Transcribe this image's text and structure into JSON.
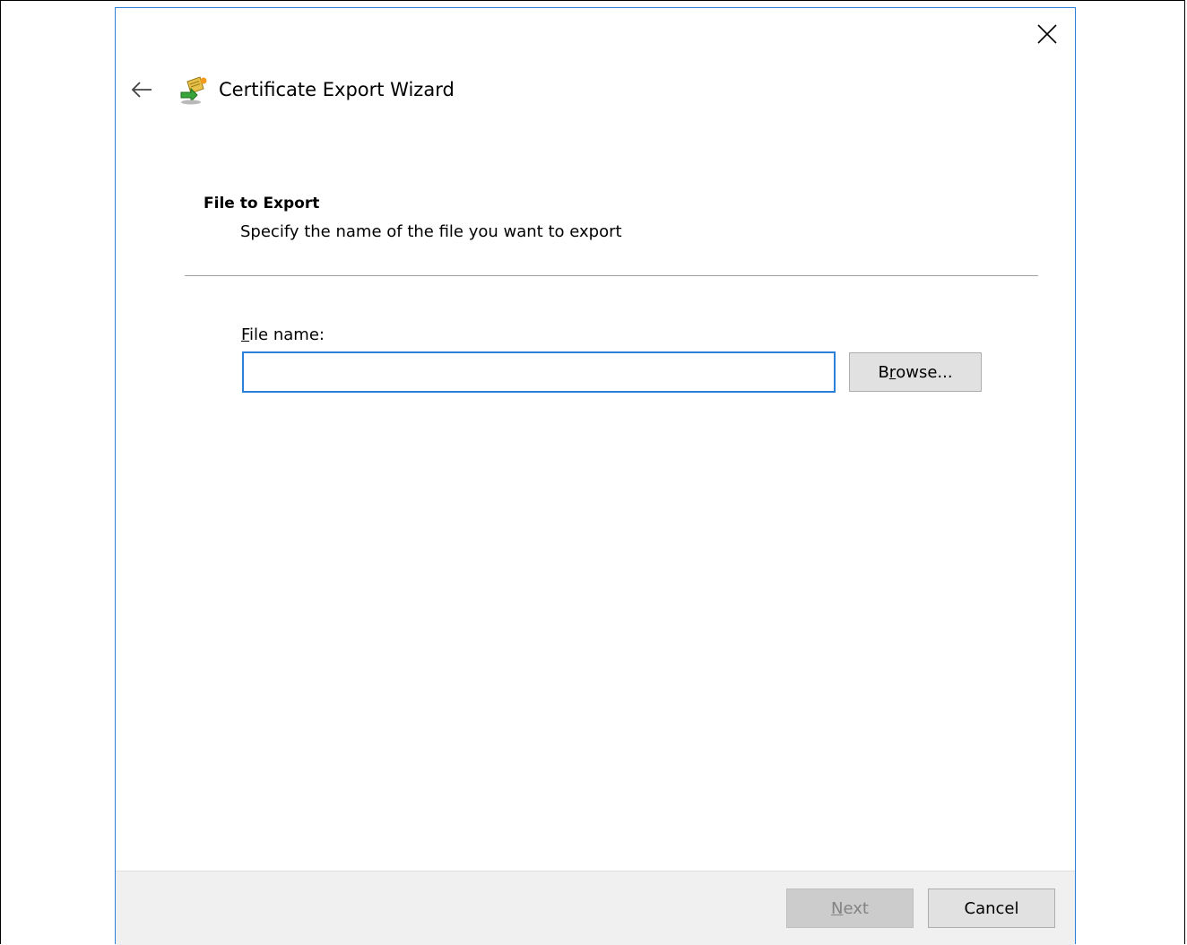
{
  "window": {
    "title": "Certificate Export Wizard",
    "close_icon": "close-icon",
    "back_icon": "back-arrow-icon",
    "app_icon": "certificate-export-icon",
    "accent_color": "#2b7fd6"
  },
  "page": {
    "heading": "File to Export",
    "subtitle": "Specify the name of the file you want to export"
  },
  "file_field": {
    "label_accesskey": "F",
    "label_rest": "ile name:",
    "value": "",
    "placeholder": ""
  },
  "browse_button": {
    "label_pre": "B",
    "label_accesskey": "r",
    "label_rest": "owse..."
  },
  "footer": {
    "next_accesskey": "N",
    "next_rest": "ext",
    "next_enabled": false,
    "cancel_label": "Cancel"
  }
}
